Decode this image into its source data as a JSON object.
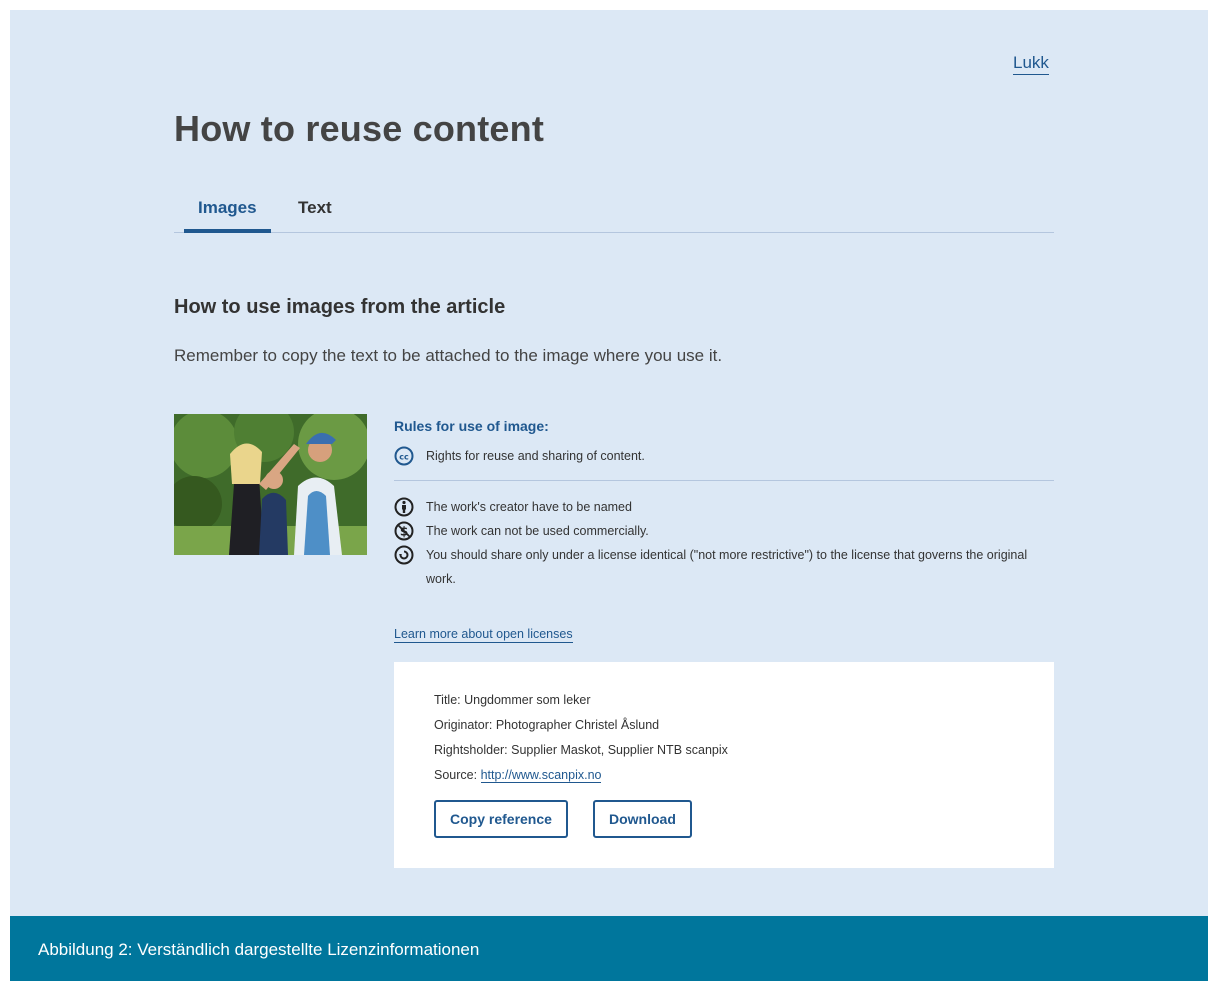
{
  "close_label": "Lukk",
  "title": "How to reuse content",
  "tabs": [
    {
      "label": "Images",
      "active": true
    },
    {
      "label": "Text",
      "active": false
    }
  ],
  "section": {
    "heading": "How to use images from the article",
    "instruction": "Remember to copy the text to be attached to the image where you use it."
  },
  "rules": {
    "title": "Rules for use of image:",
    "license": {
      "icon": "cc-icon",
      "text": "Rights for reuse and sharing of content."
    },
    "items": [
      {
        "icon": "attribution-icon",
        "text": "The work's creator have to be named"
      },
      {
        "icon": "noncommercial-icon",
        "text": "The work can not be used commercially."
      },
      {
        "icon": "sharealike-icon",
        "text": "You should share only under a license identical (\"not more restrictive\") to the license that governs the original work."
      }
    ],
    "learn_more": "Learn more about open licenses"
  },
  "reference": {
    "title": "Title: Ungdommer som leker",
    "originator": "Originator: Photographer Christel Åslund",
    "rightsholder": "Rightsholder: Supplier Maskot, Supplier NTB scanpix",
    "source_label": "Source:",
    "source_url": "http://www.scanpix.no",
    "copy_button": "Copy reference",
    "download_button": "Download"
  },
  "caption": "Abbildung 2: Verständlich dargestellte Lizenzinformationen",
  "colors": {
    "accent": "#20588f",
    "panel_bg": "#dce8f5",
    "caption_bg": "#00769c"
  }
}
